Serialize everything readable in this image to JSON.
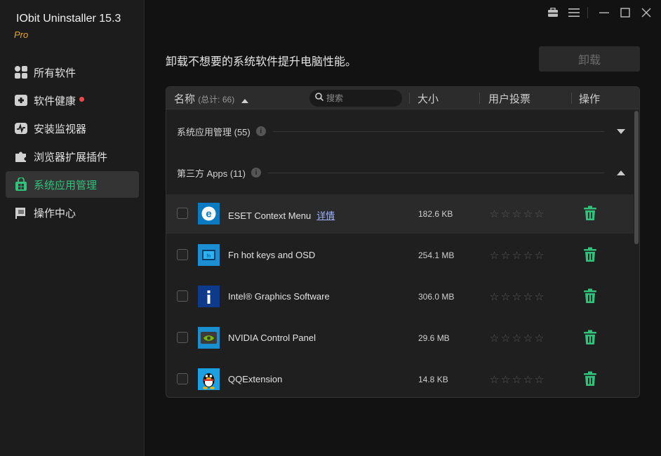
{
  "app": {
    "title": "IObit Uninstaller 15.3",
    "edition": "Pro"
  },
  "sidebar": {
    "items": [
      {
        "label": "所有软件",
        "icon": "grid-icon"
      },
      {
        "label": "软件健康",
        "icon": "health-plus-icon",
        "badge": "red-dot"
      },
      {
        "label": "安装监视器",
        "icon": "monitor-icon"
      },
      {
        "label": "浏览器扩展插件",
        "icon": "puzzle-icon"
      },
      {
        "label": "系统应用管理",
        "icon": "windows-store-icon",
        "active": true
      },
      {
        "label": "操作中心",
        "icon": "flag-icon"
      }
    ]
  },
  "window_controls": [
    "toolbox-icon",
    "menu-icon",
    "minimize-icon",
    "maximize-icon",
    "close-icon"
  ],
  "main": {
    "subtitle": "卸载不想要的系统软件提升电脑性能。",
    "uninstall_label": "卸载"
  },
  "table": {
    "col_name": "名称",
    "col_count": "(总计: 66)",
    "search_placeholder": "搜索",
    "col_size": "大小",
    "col_votes": "用户投票",
    "col_action": "操作",
    "groups": [
      {
        "label": "系统应用管理 (55)",
        "expanded": false
      },
      {
        "label": "第三方 Apps (11)",
        "expanded": true
      }
    ],
    "rows": [
      {
        "name": "ESET Context Menu",
        "detail": "详情",
        "size": "182.6 KB",
        "icon": "eset-icon",
        "highlight": true
      },
      {
        "name": "Fn hot keys and OSD",
        "size": "254.1 MB",
        "icon": "fn-keys-icon"
      },
      {
        "name": "Intel® Graphics Software",
        "size": "306.0 MB",
        "icon": "intel-icon"
      },
      {
        "name": "NVIDIA Control Panel",
        "size": "29.6 MB",
        "icon": "nvidia-icon"
      },
      {
        "name": "QQExtension",
        "size": "14.8 KB",
        "icon": "qq-penguin-icon"
      }
    ],
    "rating_max": 5,
    "rating_value": 0
  },
  "colors": {
    "accent": "#31c27c",
    "brand_pro": "#e0a82e",
    "alert": "#f0494c",
    "link": "#9fb4ff"
  }
}
